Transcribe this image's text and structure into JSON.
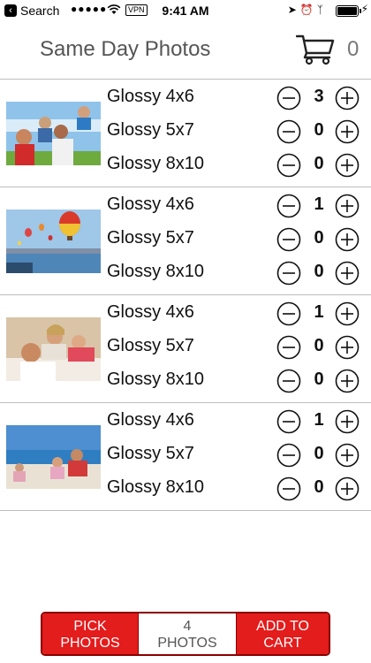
{
  "status_bar": {
    "back_label": "Search",
    "signal": "●●●●●",
    "vpn": "VPN",
    "time": "9:41 AM",
    "icons": [
      "location-icon",
      "alarm-icon",
      "bluetooth-icon",
      "battery-icon",
      "charging-icon"
    ]
  },
  "header": {
    "title": "Same Day Photos",
    "cart_count": "0",
    "cart_icon": "cart-icon"
  },
  "photos": [
    {
      "image": "family-outdoors-photo",
      "items": [
        {
          "label": "Glossy 4x6",
          "qty": "3"
        },
        {
          "label": "Glossy 5x7",
          "qty": "0"
        },
        {
          "label": "Glossy 8x10",
          "qty": "0"
        }
      ]
    },
    {
      "image": "hot-air-balloons-photo",
      "items": [
        {
          "label": "Glossy 4x6",
          "qty": "1"
        },
        {
          "label": "Glossy 5x7",
          "qty": "0"
        },
        {
          "label": "Glossy 8x10",
          "qty": "0"
        }
      ]
    },
    {
      "image": "family-lying-photo",
      "items": [
        {
          "label": "Glossy 4x6",
          "qty": "1"
        },
        {
          "label": "Glossy 5x7",
          "qty": "0"
        },
        {
          "label": "Glossy 8x10",
          "qty": "0"
        }
      ]
    },
    {
      "image": "family-beach-photo",
      "items": [
        {
          "label": "Glossy 4x6",
          "qty": "1"
        },
        {
          "label": "Glossy 5x7",
          "qty": "0"
        },
        {
          "label": "Glossy 8x10",
          "qty": "0"
        }
      ]
    }
  ],
  "bottom_bar": {
    "pick_line1": "PICK",
    "pick_line2": "PHOTOS",
    "count_line1": "4",
    "count_line2": "PHOTOS",
    "add_line1": "ADD TO",
    "add_line2": "CART"
  },
  "colors": {
    "accent": "#e31c1c",
    "accent_border": "#8a0000",
    "divider": "#bdbdbd"
  }
}
